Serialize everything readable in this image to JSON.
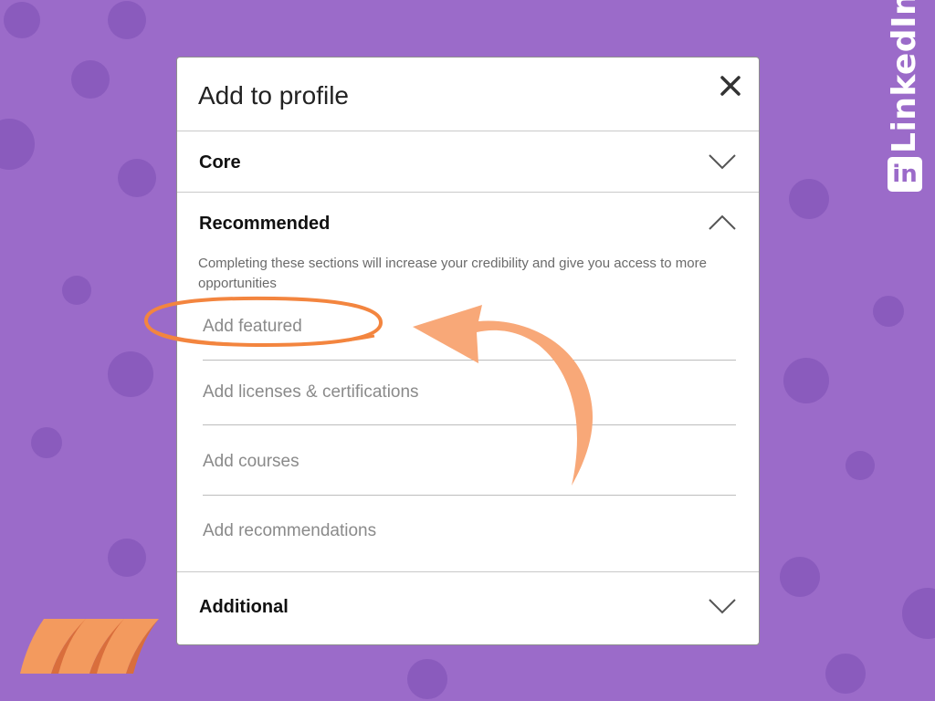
{
  "brand": {
    "name": "LinkedIn",
    "logo_text": "in"
  },
  "modal": {
    "title": "Add to profile",
    "close_icon": "close-icon",
    "sections": {
      "core": {
        "title": "Core",
        "state": "collapsed"
      },
      "recommended": {
        "title": "Recommended",
        "state": "expanded",
        "description": "Completing these sections will increase your credibility and give you access to more opportunities",
        "items": [
          "Add featured",
          "Add licenses & certifications",
          "Add courses",
          "Add recommendations"
        ]
      },
      "additional": {
        "title": "Additional",
        "state": "collapsed"
      }
    }
  },
  "colors": {
    "background": "#9b6bc9",
    "dots": "#8a5bbd",
    "highlight": "#f3853f",
    "arrow": "#f8a878"
  }
}
